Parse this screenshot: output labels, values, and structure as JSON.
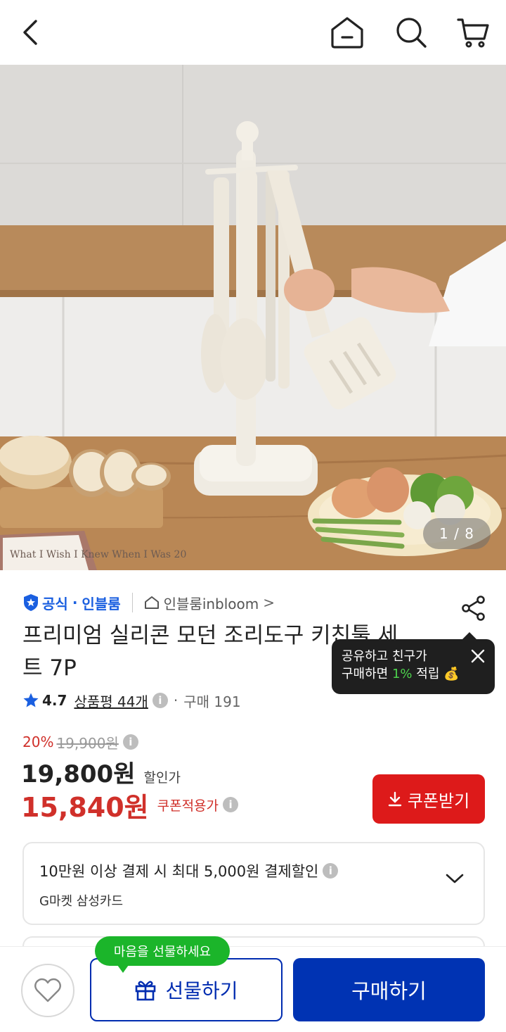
{
  "header": {
    "back_icon": "chevron-left-icon",
    "home_icon": "home-icon",
    "search_icon": "search-icon",
    "cart_icon": "cart-icon"
  },
  "hero": {
    "image_counter": "1 / 8",
    "book_title": "What I Wish I Knew When I Was 20"
  },
  "seller": {
    "official_label": "공식",
    "separator": "·",
    "brand": "인블룸",
    "store_name": "인블룸inbloom",
    "store_chevron": ">"
  },
  "product": {
    "title": "프리미엄 실리콘 모던 조리도구 키친툴 세트 7P"
  },
  "share_tooltip": {
    "line1": "공유하고 친구가",
    "line2_prefix": "구매하면 ",
    "line2_pct": "1%",
    "line2_suffix": " 적립",
    "emoji": "💰"
  },
  "rating": {
    "score": "4.7",
    "review_label": "상품평 44개",
    "info": "i",
    "purchase_sep": "·",
    "purchase_count": "구매 191"
  },
  "pricing": {
    "discount_pct": "20%",
    "original_price": "19,900원",
    "sale_price": "19,800원",
    "sale_label": "할인가",
    "coupon_price": "15,840원",
    "coupon_label": "쿠폰적용가",
    "coupon_button": "쿠폰받기",
    "info": "i"
  },
  "card_benefit": {
    "title": "10만원 이상 결제 시 최대 5,000원 결제할인",
    "card_name": "G마켓 삼성카드",
    "info": "i"
  },
  "bottom": {
    "gift_bubble": "마음을 선물하세요",
    "gift_button": "선물하기",
    "buy_button": "구매하기"
  },
  "colors": {
    "primary_blue": "#0033b3",
    "red": "#dd1a1a",
    "green": "#1bb52a"
  }
}
